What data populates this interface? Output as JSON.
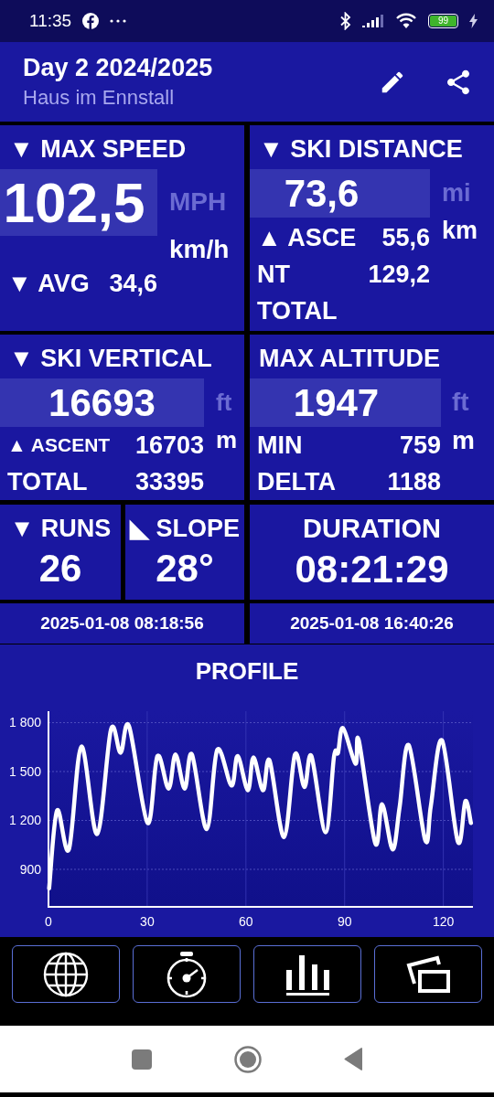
{
  "status_bar": {
    "time": "11:35",
    "battery": "99"
  },
  "header": {
    "title": "Day 2 2024/2025",
    "subtitle": "Haus im Ennstall"
  },
  "tiles": [
    {
      "kind": "stat",
      "title": "▼ MAX SPEED",
      "value": "102,5",
      "units": [
        {
          "label": "MPH",
          "selected": false
        },
        {
          "label": "km/h",
          "selected": true
        }
      ],
      "rows": [
        {
          "label": "▼ AVG",
          "value": "34,6"
        }
      ]
    },
    {
      "kind": "stat",
      "title": "▼ SKI DISTANCE",
      "value": "73,6",
      "units": [
        {
          "label": "mi",
          "selected": false
        },
        {
          "label": "km",
          "selected": true
        }
      ],
      "rows": [
        {
          "label": "▲ ASCE",
          "value": "55,6"
        },
        {
          "label": "NT",
          "value": "129,2"
        },
        {
          "label": "TOTAL"
        }
      ]
    },
    {
      "kind": "stat",
      "title": "▼ SKI VERTICAL",
      "value": "16693",
      "units": [
        {
          "label": "ft",
          "selected": false
        },
        {
          "label": "m",
          "selected": true
        }
      ],
      "rows": [
        {
          "label": "▲ ASCENT",
          "value": "16703"
        },
        {
          "label": "TOTAL",
          "value": "33395"
        }
      ]
    },
    {
      "kind": "stat",
      "title": "MAX ALTITUDE",
      "value": "1947",
      "units": [
        {
          "label": "ft",
          "selected": false
        },
        {
          "label": "m",
          "selected": true
        }
      ],
      "rows": [
        {
          "label": "MIN",
          "value": "759"
        },
        {
          "label": "DELTA",
          "value": "1188"
        }
      ]
    }
  ],
  "counters": [
    {
      "title": "▼ RUNS",
      "value": "26"
    },
    {
      "title": "◣ SLOPE",
      "value": "28°"
    },
    {
      "title": "DURATION",
      "value": "08:21:29"
    }
  ],
  "timestamps": [
    "2025-01-08 08:18:56",
    "2025-01-08 16:40:26"
  ],
  "profile": {
    "chart_data": {
      "type": "line",
      "title": "PROFILE",
      "grid": true,
      "xlim": [
        0,
        129
      ],
      "ylim": [
        670,
        1870
      ],
      "xticks": [
        0,
        30,
        60,
        90,
        120
      ],
      "yticks": [
        {
          "value": 900,
          "label": "900"
        },
        {
          "value": 1200,
          "label": "1 200"
        },
        {
          "value": 1500,
          "label": "1 500"
        },
        {
          "value": 1800,
          "label": "1 800"
        }
      ],
      "x": [
        0.2,
        2.6,
        6.2,
        10,
        14.8,
        19,
        21.9,
        24.5,
        30.1,
        33.1,
        36.5,
        38.6,
        41.4,
        43.6,
        48.1,
        51.3,
        55.6,
        57.5,
        60.6,
        62.3,
        65.2,
        67.2,
        71.6,
        74.9,
        77.8,
        79.9,
        84.2,
        86.8,
        88,
        89.5,
        93.3,
        94.3,
        99.3,
        101.4,
        104.6,
        106.7,
        109.5,
        114.5,
        116.2,
        119.6,
        124.4,
        126.7,
        128.4
      ],
      "series": [
        {
          "color": "#ffffff",
          "values": [
            783,
            1261,
            1022,
            1653,
            1117,
            1758,
            1615,
            1777,
            1184,
            1595,
            1395,
            1605,
            1395,
            1605,
            1146,
            1634,
            1414,
            1595,
            1385,
            1586,
            1385,
            1567,
            1098,
            1605,
            1404,
            1595,
            1127,
            1595,
            1615,
            1767,
            1548,
            1691,
            1060,
            1299,
            1022,
            1280,
            1662,
            1079,
            1290,
            1691,
            1070,
            1318,
            1184
          ]
        }
      ]
    }
  }
}
